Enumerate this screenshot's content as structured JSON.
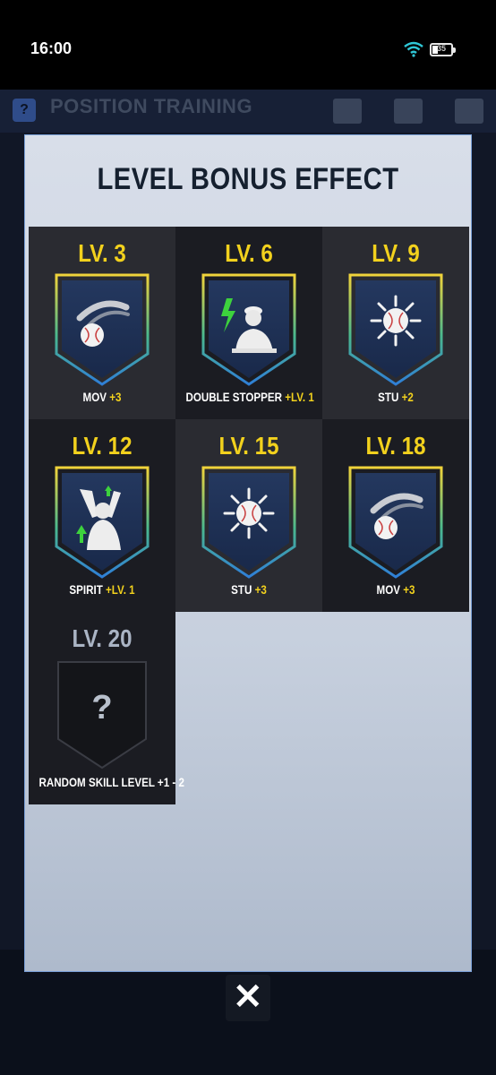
{
  "status_bar": {
    "time": "16:00",
    "battery": "35"
  },
  "background_app": {
    "help_icon": "?",
    "title": "POSITION TRAINING"
  },
  "modal": {
    "title": "LEVEL BONUS EFFECT",
    "bonuses": [
      {
        "level": "LV. 3",
        "icon": "ball-movement-icon",
        "skill": "MOV",
        "bonus": "+3"
      },
      {
        "level": "LV. 6",
        "icon": "double-stopper-icon",
        "skill": "DOUBLE STOPPER",
        "bonus": "+LV. 1"
      },
      {
        "level": "LV. 9",
        "icon": "ball-stuff-icon",
        "skill": "STU",
        "bonus": "+2"
      },
      {
        "level": "LV. 12",
        "icon": "spirit-icon",
        "skill": "SPIRIT",
        "bonus": "+LV. 1"
      },
      {
        "level": "LV. 15",
        "icon": "ball-stuff-icon",
        "skill": "STU",
        "bonus": "+3"
      },
      {
        "level": "LV. 18",
        "icon": "ball-movement-icon",
        "skill": "MOV",
        "bonus": "+3"
      },
      {
        "level": "LV. 20",
        "icon": "mystery-icon",
        "skill": "RANDOM SKILL LEVEL +1 - 2",
        "bonus": "",
        "mystery_mark": "?"
      }
    ]
  },
  "close_button": {
    "label": "✕"
  },
  "colors": {
    "gold": "#f2d11d",
    "modal_bg": "#d8dee9",
    "tile_dark": "#1b1c22",
    "tile_light": "#2a2b31"
  }
}
